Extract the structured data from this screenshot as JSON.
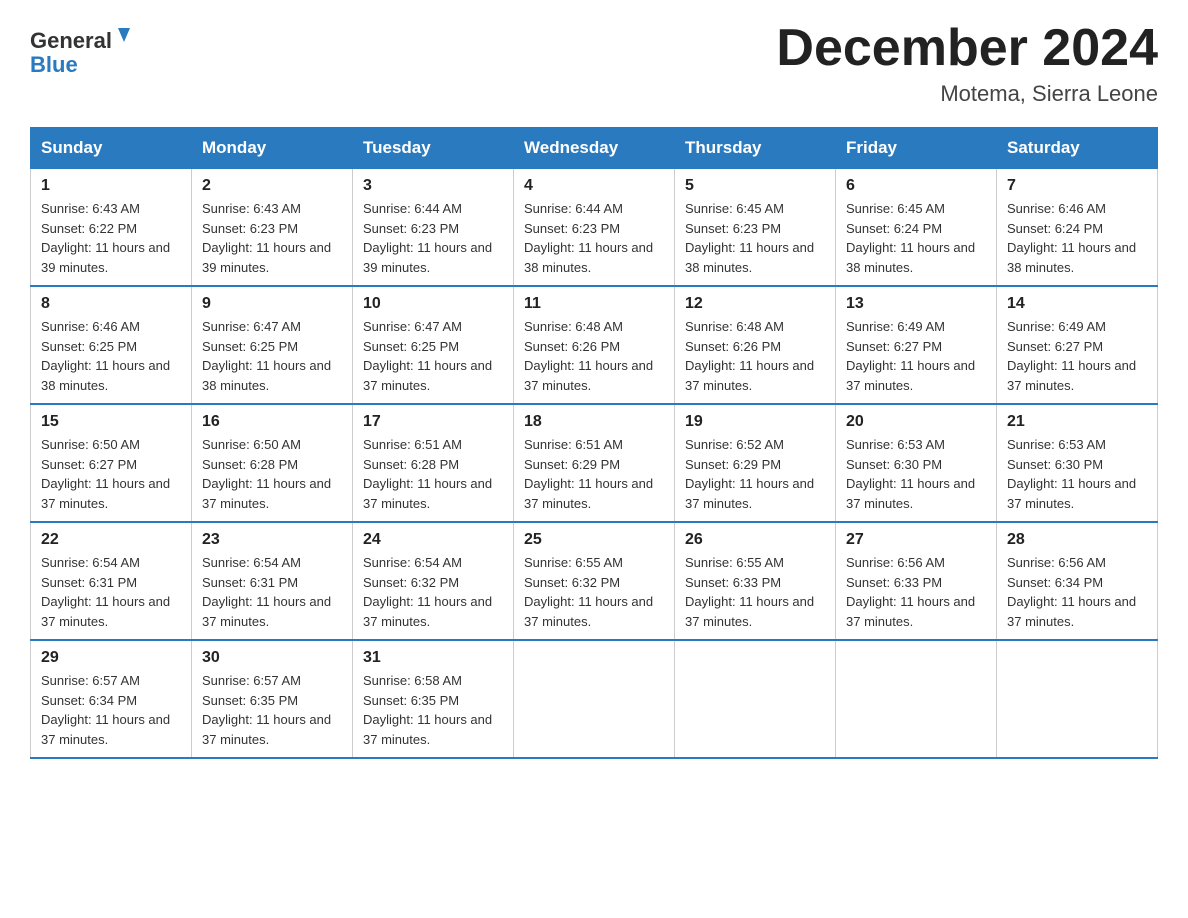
{
  "header": {
    "logo_general": "General",
    "logo_blue": "Blue",
    "month_title": "December 2024",
    "location": "Motema, Sierra Leone"
  },
  "days_of_week": [
    "Sunday",
    "Monday",
    "Tuesday",
    "Wednesday",
    "Thursday",
    "Friday",
    "Saturday"
  ],
  "weeks": [
    [
      {
        "day": "1",
        "sunrise": "6:43 AM",
        "sunset": "6:22 PM",
        "daylight": "11 hours and 39 minutes."
      },
      {
        "day": "2",
        "sunrise": "6:43 AM",
        "sunset": "6:23 PM",
        "daylight": "11 hours and 39 minutes."
      },
      {
        "day": "3",
        "sunrise": "6:44 AM",
        "sunset": "6:23 PM",
        "daylight": "11 hours and 39 minutes."
      },
      {
        "day": "4",
        "sunrise": "6:44 AM",
        "sunset": "6:23 PM",
        "daylight": "11 hours and 38 minutes."
      },
      {
        "day": "5",
        "sunrise": "6:45 AM",
        "sunset": "6:23 PM",
        "daylight": "11 hours and 38 minutes."
      },
      {
        "day": "6",
        "sunrise": "6:45 AM",
        "sunset": "6:24 PM",
        "daylight": "11 hours and 38 minutes."
      },
      {
        "day": "7",
        "sunrise": "6:46 AM",
        "sunset": "6:24 PM",
        "daylight": "11 hours and 38 minutes."
      }
    ],
    [
      {
        "day": "8",
        "sunrise": "6:46 AM",
        "sunset": "6:25 PM",
        "daylight": "11 hours and 38 minutes."
      },
      {
        "day": "9",
        "sunrise": "6:47 AM",
        "sunset": "6:25 PM",
        "daylight": "11 hours and 38 minutes."
      },
      {
        "day": "10",
        "sunrise": "6:47 AM",
        "sunset": "6:25 PM",
        "daylight": "11 hours and 37 minutes."
      },
      {
        "day": "11",
        "sunrise": "6:48 AM",
        "sunset": "6:26 PM",
        "daylight": "11 hours and 37 minutes."
      },
      {
        "day": "12",
        "sunrise": "6:48 AM",
        "sunset": "6:26 PM",
        "daylight": "11 hours and 37 minutes."
      },
      {
        "day": "13",
        "sunrise": "6:49 AM",
        "sunset": "6:27 PM",
        "daylight": "11 hours and 37 minutes."
      },
      {
        "day": "14",
        "sunrise": "6:49 AM",
        "sunset": "6:27 PM",
        "daylight": "11 hours and 37 minutes."
      }
    ],
    [
      {
        "day": "15",
        "sunrise": "6:50 AM",
        "sunset": "6:27 PM",
        "daylight": "11 hours and 37 minutes."
      },
      {
        "day": "16",
        "sunrise": "6:50 AM",
        "sunset": "6:28 PM",
        "daylight": "11 hours and 37 minutes."
      },
      {
        "day": "17",
        "sunrise": "6:51 AM",
        "sunset": "6:28 PM",
        "daylight": "11 hours and 37 minutes."
      },
      {
        "day": "18",
        "sunrise": "6:51 AM",
        "sunset": "6:29 PM",
        "daylight": "11 hours and 37 minutes."
      },
      {
        "day": "19",
        "sunrise": "6:52 AM",
        "sunset": "6:29 PM",
        "daylight": "11 hours and 37 minutes."
      },
      {
        "day": "20",
        "sunrise": "6:53 AM",
        "sunset": "6:30 PM",
        "daylight": "11 hours and 37 minutes."
      },
      {
        "day": "21",
        "sunrise": "6:53 AM",
        "sunset": "6:30 PM",
        "daylight": "11 hours and 37 minutes."
      }
    ],
    [
      {
        "day": "22",
        "sunrise": "6:54 AM",
        "sunset": "6:31 PM",
        "daylight": "11 hours and 37 minutes."
      },
      {
        "day": "23",
        "sunrise": "6:54 AM",
        "sunset": "6:31 PM",
        "daylight": "11 hours and 37 minutes."
      },
      {
        "day": "24",
        "sunrise": "6:54 AM",
        "sunset": "6:32 PM",
        "daylight": "11 hours and 37 minutes."
      },
      {
        "day": "25",
        "sunrise": "6:55 AM",
        "sunset": "6:32 PM",
        "daylight": "11 hours and 37 minutes."
      },
      {
        "day": "26",
        "sunrise": "6:55 AM",
        "sunset": "6:33 PM",
        "daylight": "11 hours and 37 minutes."
      },
      {
        "day": "27",
        "sunrise": "6:56 AM",
        "sunset": "6:33 PM",
        "daylight": "11 hours and 37 minutes."
      },
      {
        "day": "28",
        "sunrise": "6:56 AM",
        "sunset": "6:34 PM",
        "daylight": "11 hours and 37 minutes."
      }
    ],
    [
      {
        "day": "29",
        "sunrise": "6:57 AM",
        "sunset": "6:34 PM",
        "daylight": "11 hours and 37 minutes."
      },
      {
        "day": "30",
        "sunrise": "6:57 AM",
        "sunset": "6:35 PM",
        "daylight": "11 hours and 37 minutes."
      },
      {
        "day": "31",
        "sunrise": "6:58 AM",
        "sunset": "6:35 PM",
        "daylight": "11 hours and 37 minutes."
      },
      null,
      null,
      null,
      null
    ]
  ]
}
